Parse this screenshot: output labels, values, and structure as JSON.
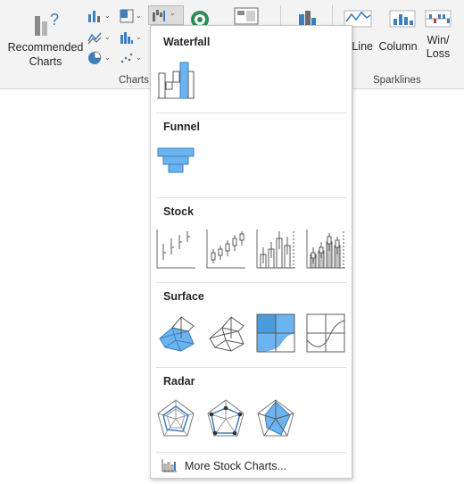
{
  "ribbon": {
    "recommended_charts_label": "Recommended Charts",
    "charts_group_label": "Charts",
    "sparklines_group_label": "Sparklines",
    "sparkline_line_label": "Line",
    "sparkline_column_label": "Column",
    "sparkline_winloss_label": "Win/ Loss"
  },
  "menu": {
    "sections": {
      "waterfall": "Waterfall",
      "funnel": "Funnel",
      "stock": "Stock",
      "surface": "Surface",
      "radar": "Radar"
    },
    "more_label": "More Stock Charts..."
  },
  "colors": {
    "accent_blue": "#4a9ade",
    "fill_blue": "#6cb4f0",
    "ribbon_bg": "#f3f3f3"
  }
}
